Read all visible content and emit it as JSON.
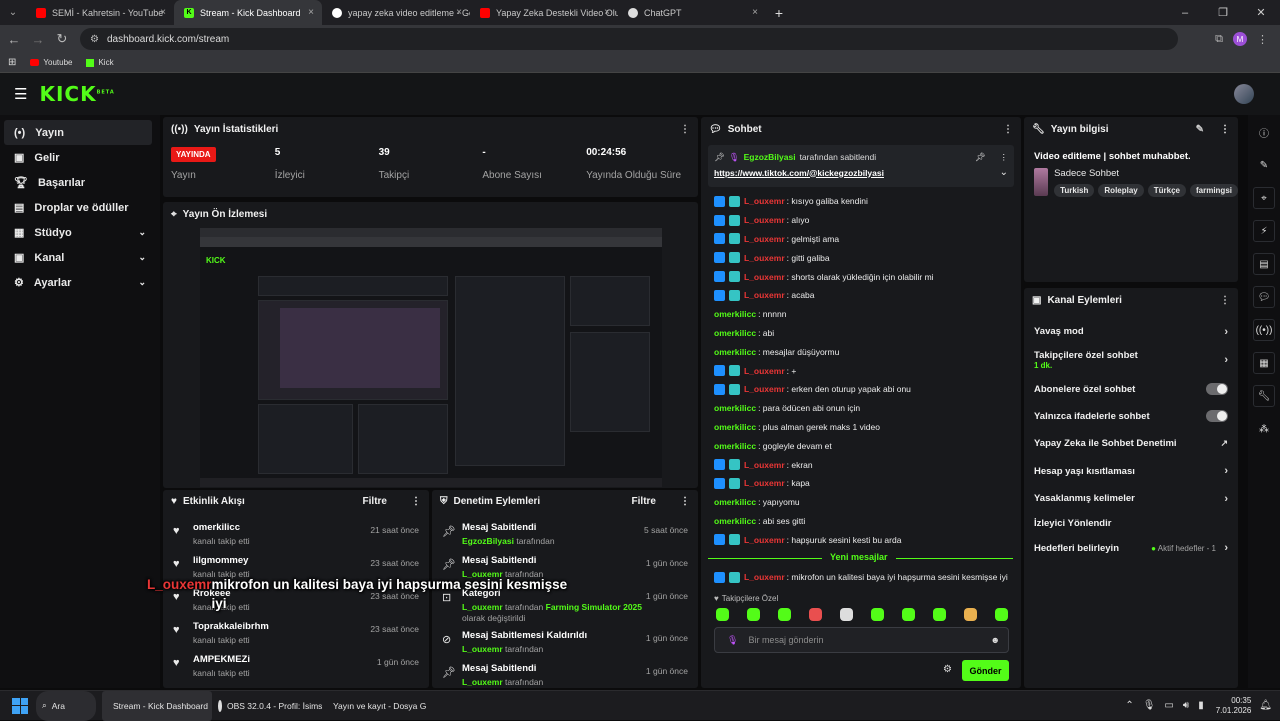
{
  "browser": {
    "tabs": [
      {
        "label": "SEMİ - Kahretsin - YouTube",
        "icon": "youtube-icon",
        "color": "#ff0000"
      },
      {
        "label": "Stream - Kick Dashboard",
        "icon": "kick-icon",
        "color": "#53fc18"
      },
      {
        "label": "yapay zeka video editleme - Go",
        "icon": "google-icon",
        "color": "#ffffff"
      },
      {
        "label": "Yapay Zeka Destekli Video Oluş",
        "icon": "youtube-icon",
        "color": "#ff0000"
      },
      {
        "label": "ChatGPT",
        "icon": "chatgpt-icon",
        "color": "#ffffff"
      }
    ],
    "url": "dashboard.kick.com/stream",
    "bookmarks": [
      "Youtube",
      "Kick"
    ],
    "profile_initial": "M"
  },
  "sidebar": {
    "items": [
      {
        "label": "Yayın",
        "icon": "broadcast-icon"
      },
      {
        "label": "Gelir",
        "icon": "money-icon"
      },
      {
        "label": "Başarılar",
        "icon": "trophy-icon"
      },
      {
        "label": "Droplar ve ödüller",
        "icon": "gift-icon"
      },
      {
        "label": "Stüdyo",
        "icon": "layout-icon"
      },
      {
        "label": "Kanal",
        "icon": "user-icon"
      },
      {
        "label": "Ayarlar",
        "icon": "gear-icon"
      }
    ]
  },
  "stats": {
    "title": "Yayın İstatistikleri",
    "items": [
      {
        "value": "YAYINDA",
        "label": "Yayın"
      },
      {
        "value": "5",
        "label": "İzleyici"
      },
      {
        "value": "39",
        "label": "Takipçi"
      },
      {
        "value": "-",
        "label": "Abone Sayısı"
      },
      {
        "value": "00:24:56",
        "label": "Yayında Olduğu Süre"
      }
    ]
  },
  "preview": {
    "title": "Yayın Ön İzlemesi"
  },
  "activity": {
    "title": "Etkinlik Akışı",
    "filter": "Filtre",
    "items": [
      {
        "name": "omerkilicc",
        "sub": "kanalı takip etti",
        "time": "21 saat önce"
      },
      {
        "name": "lilgmommey",
        "sub": "kanalı takip etti",
        "time": "23 saat önce"
      },
      {
        "name": "Rrokeee",
        "sub": "kanalı takip etti",
        "time": "23 saat önce"
      },
      {
        "name": "Toprakkaleibrhm",
        "sub": "kanalı takip etti",
        "time": "23 saat önce"
      },
      {
        "name": "AMPEKMEZi",
        "sub": "kanalı takip etti",
        "time": "1 gün önce"
      }
    ]
  },
  "moderation": {
    "title": "Denetim Eylemleri",
    "filter": "Filtre",
    "items": [
      {
        "action": "Mesaj Sabitlendi",
        "user": "EgzozBilyasi",
        "rest": " tarafından",
        "time": "5 saat önce",
        "icon": "pin-icon"
      },
      {
        "action": "Mesaj Sabitlendi",
        "user": "L_ouxemr",
        "rest": " tarafından",
        "time": "1 gün önce",
        "icon": "pin-icon"
      },
      {
        "action": "Kategori",
        "user": "L_ouxemr",
        "rest": " tarafından ",
        "extra": "Farming Simulator 2025",
        "rest2": " olarak değiştirildi",
        "time": "1 gün önce",
        "icon": "category-icon"
      },
      {
        "action": "Mesaj Sabitlemesi Kaldırıldı",
        "user": "L_ouxemr",
        "rest": " tarafından",
        "time": "1 gün önce",
        "icon": "unpin-icon"
      },
      {
        "action": "Mesaj Sabitlendi",
        "user": "L_ouxemr",
        "rest": " tarafından",
        "time": "1 gün önce",
        "icon": "pin-icon"
      }
    ]
  },
  "chat": {
    "title": "Sohbet",
    "pinned_by": "EgzozBilyasi",
    "pinned_suffix": " tarafından sabitlendi",
    "pinned_link": "https://www.tiktok.com/@kickegzozbilyasi",
    "messages": [
      {
        "user": "L_ouxemr",
        "badges": true,
        "text": ": kısıyo galiba kendini"
      },
      {
        "user": "L_ouxemr",
        "badges": true,
        "text": ": alıyo"
      },
      {
        "user": "L_ouxemr",
        "badges": true,
        "text": ": gelmişti ama"
      },
      {
        "user": "L_ouxemr",
        "badges": true,
        "text": ": gitti galiba"
      },
      {
        "user": "L_ouxemr",
        "badges": true,
        "text": ": shorts olarak yüklediğin için olabilir mi"
      },
      {
        "user": "L_ouxemr",
        "badges": true,
        "text": ": acaba"
      },
      {
        "user": "omerkilicc",
        "badges": false,
        "text": ": nnnnn"
      },
      {
        "user": "omerkilicc",
        "badges": false,
        "text": ": abi"
      },
      {
        "user": "omerkilicc",
        "badges": false,
        "text": ": mesajlar düşüyormu"
      },
      {
        "user": "L_ouxemr",
        "badges": true,
        "text": ": +"
      },
      {
        "user": "L_ouxemr",
        "badges": true,
        "text": ": erken den oturup yapak abi onu"
      },
      {
        "user": "omerkilicc",
        "badges": false,
        "text": ": para ödücen abi onun için"
      },
      {
        "user": "omerkilicc",
        "badges": false,
        "text": ": plus alman gerek maks 1 video"
      },
      {
        "user": "omerkilicc",
        "badges": false,
        "text": ": gogleyle devam et"
      },
      {
        "user": "L_ouxemr",
        "badges": true,
        "text": ": ekran"
      },
      {
        "user": "L_ouxemr",
        "badges": true,
        "text": ": kapa"
      },
      {
        "user": "omerkilicc",
        "badges": false,
        "text": ": yapıyomu"
      },
      {
        "user": "omerkilicc",
        "badges": false,
        "text": ": abi ses gitti"
      },
      {
        "user": "L_ouxemr",
        "badges": true,
        "text": ": hapşuruk sesini kesti bu arda"
      }
    ],
    "new_messages": "Yeni mesajlar",
    "last_message": {
      "user": "L_ouxemr",
      "text": ": mikrofon un kalitesi baya iyi hapşurma sesini kesmişse iyi"
    },
    "mode_label": "Takipçilere Özel",
    "placeholder": "Bir mesaj gönderin",
    "send": "Gönder"
  },
  "stream_info": {
    "title": "Yayın bilgisi",
    "stream_title": "Video editleme | sohbet muhabbet.",
    "category": "Sadece Sohbet",
    "tags": [
      "Turkish",
      "Roleplay",
      "Türkçe",
      "farmingsi"
    ]
  },
  "channel_actions": {
    "title": "Kanal Eylemleri",
    "items": [
      {
        "label": "Yavaş mod",
        "type": "chevron"
      },
      {
        "label": "Takipçilere özel sohbet",
        "sub": "1 dk.",
        "type": "chevron"
      },
      {
        "label": "Abonelere özel sohbet",
        "type": "toggle"
      },
      {
        "label": "Yalnızca ifadelerle sohbet",
        "type": "toggle"
      },
      {
        "label": "Yapay Zeka ile Sohbet Denetimi",
        "type": "external"
      },
      {
        "label": "Hesap yaşı kısıtlaması",
        "type": "chevron"
      },
      {
        "label": "Yasaklanmış kelimeler",
        "type": "chevron"
      },
      {
        "label": "İzleyici Yönlendir",
        "type": "none"
      },
      {
        "label": "Hedefleri belirleyin",
        "status": "Aktif hedefler - 1",
        "type": "chevron"
      }
    ]
  },
  "overlay_caption": {
    "user": "L_ouxemr",
    "text": " mikrofon un kalitesi baya iyi hapşurma sesini kesmişse iyi"
  },
  "taskbar": {
    "search": "Ara",
    "apps": [
      "Stream - Kick Dashboard",
      "OBS 32.0.4 - Profil: İsims",
      "Yayın ve kayıt - Dosya G"
    ],
    "time": "00:35",
    "date": "7.01.2026"
  },
  "colors": {
    "brand": "#53fc18",
    "live": "#e91916",
    "mention": "#e93636"
  }
}
